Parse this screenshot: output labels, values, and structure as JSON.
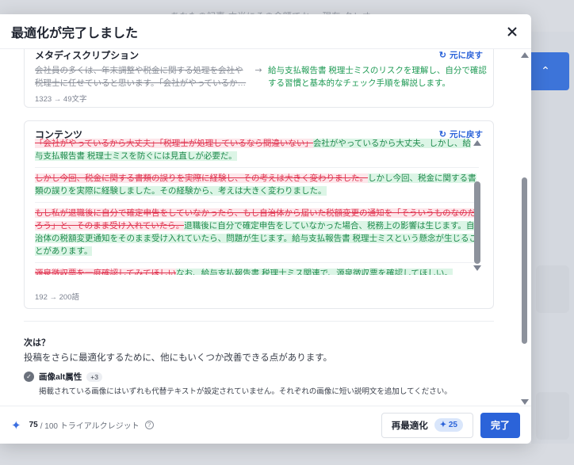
{
  "background": {
    "topbar_text": "あなたの記事 本当にその金額でか… 現在 クレオ"
  },
  "dialog": {
    "title": "最適化が完了しました"
  },
  "meta_section": {
    "title": "メタディスクリプション",
    "revert_label": "元に戻す",
    "old_text": "会社員の多くは、年末調整や税金に関する処理を会社や税理士に任せていると思います。「会社がやっているか…",
    "arrow": "→",
    "new_text": "給与支払報告書 税理士ミスのリスクを理解し、自分で確認する習慣と基本的なチェック手順を解説します。",
    "count": "1323 → 49文字"
  },
  "content_section": {
    "title": "コンテンツ",
    "revert_label": "元に戻す",
    "count": "192 → 200語",
    "paragraphs": [
      {
        "del": "「会社がやっているから大丈夫」「税理士が処理しているなら間違いない」",
        "ins": "会社がやっているから大丈夫。しかし、給与支払報告書 税理士ミスを防ぐには見直しが必要だ。"
      },
      {
        "del": "しかし今回、税金に関する書類の誤りを実際に経験し、その考えは大きく変わりました。",
        "ins": "しかし今回、税金に関する書類の誤りを実際に経験しました。その経験から、考えは大きく変わりました。"
      },
      {
        "del": "もし私が退職後に自分で確定申告をしていなかったら、もし自治体から届いた税額変更の通知を「そういうものなのだろう」と、そのまま受け入れていたら。",
        "ins": "退職後に自分で確定申告をしていなかった場合、税務上の影響は生じます。自治体の税額変更通知をそのまま受け入れていたら、問題が生じます。給与支払報告書 税理士ミスという懸念が生じることがあります。"
      },
      {
        "del": "源泉徴収票を一度確認してみてほしい",
        "ins": "なお、給与支払報告書 税理士ミス関連で、源泉徴収票を確認してほしい。"
      }
    ]
  },
  "next": {
    "title": "次は？",
    "description": "投稿をさらに最適化するために、他にもいくつか改善できる点があります。",
    "tip": {
      "title": "画像alt属性",
      "badge": "+3",
      "description": "掲載されている画像にはいずれも代替テキストが設定されていません。それぞれの画像に短い説明文を追加してください。"
    }
  },
  "footer": {
    "credits_used": "75",
    "credits_rest": "/ 100 トライアルクレジット",
    "reoptimize_label": "再最適化",
    "reoptimize_cost": "25",
    "done_label": "完了"
  },
  "colors": {
    "accent": "#2b63d9",
    "deleted": "#e0334f",
    "inserted": "#1e8a4c"
  }
}
